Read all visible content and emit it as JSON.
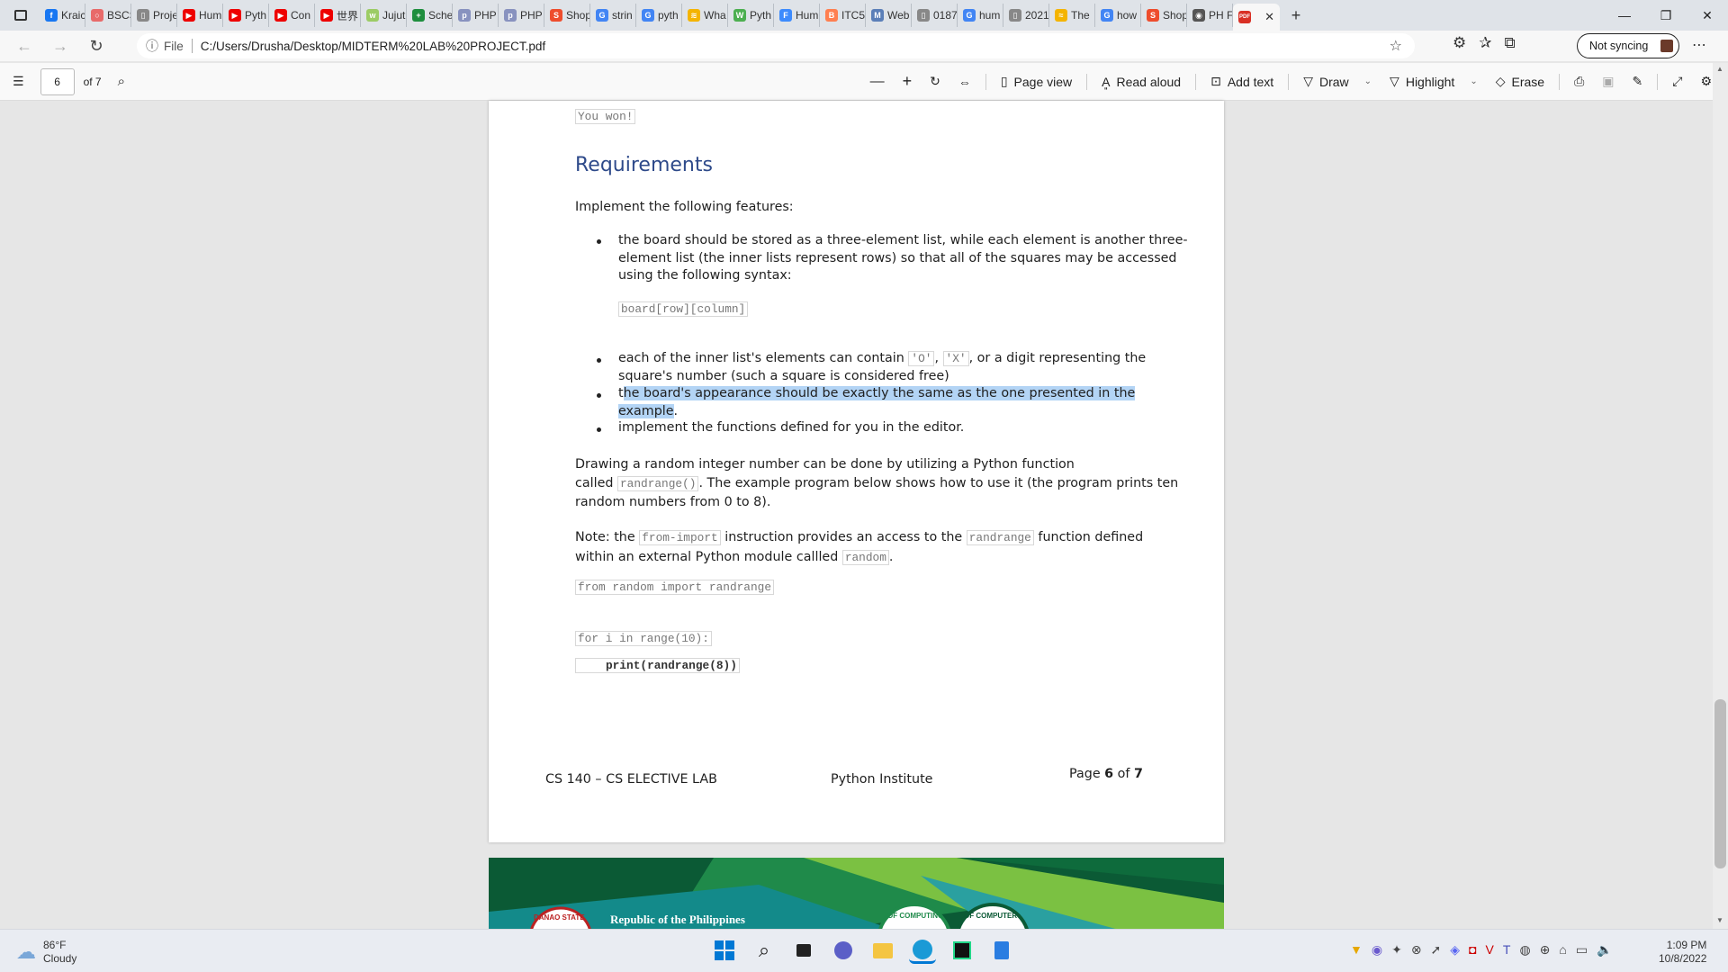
{
  "tabs": [
    {
      "label": "Kraic",
      "color": "#1877f2",
      "glyph": "f"
    },
    {
      "label": "BSCS",
      "color": "#e86a6a",
      "glyph": "○"
    },
    {
      "label": "Proje",
      "color": "#888",
      "glyph": "▯"
    },
    {
      "label": "Hum",
      "color": "#e00",
      "glyph": "▶"
    },
    {
      "label": "Pyth",
      "color": "#e00",
      "glyph": "▶"
    },
    {
      "label": "Con",
      "color": "#e00",
      "glyph": "▶"
    },
    {
      "label": "世界",
      "color": "#e00",
      "glyph": "▶"
    },
    {
      "label": "Jujut",
      "color": "#9ccc65",
      "glyph": "w"
    },
    {
      "label": "Sche",
      "color": "#1e8e3e",
      "glyph": "+"
    },
    {
      "label": "PHP",
      "color": "#8892bf",
      "glyph": "p"
    },
    {
      "label": "PHP",
      "color": "#8892bf",
      "glyph": "p"
    },
    {
      "label": "Shop",
      "color": "#ee4d2d",
      "glyph": "S"
    },
    {
      "label": "strin",
      "color": "#4285f4",
      "glyph": "G"
    },
    {
      "label": "pyth",
      "color": "#4285f4",
      "glyph": "G"
    },
    {
      "label": "Wha",
      "color": "#f4b400",
      "glyph": "≋"
    },
    {
      "label": "Pyth",
      "color": "#4caf50",
      "glyph": "W"
    },
    {
      "label": "Hum",
      "color": "#3d8bfd",
      "glyph": "F"
    },
    {
      "label": "ITC5",
      "color": "#ff7f50",
      "glyph": "B"
    },
    {
      "label": "Web",
      "color": "#5b7fb8",
      "glyph": "M"
    },
    {
      "label": "0187",
      "color": "#888",
      "glyph": "▯"
    },
    {
      "label": "hum",
      "color": "#4285f4",
      "glyph": "G"
    },
    {
      "label": "2021",
      "color": "#888",
      "glyph": "▯"
    },
    {
      "label": "The",
      "color": "#f4b400",
      "glyph": "≈"
    },
    {
      "label": "how",
      "color": "#4285f4",
      "glyph": "G"
    },
    {
      "label": "Shop",
      "color": "#ee4d2d",
      "glyph": "S"
    },
    {
      "label": "PH F",
      "color": "#555",
      "glyph": "◉"
    }
  ],
  "active_tab": {
    "glyph": "PDF",
    "close": "✕"
  },
  "newtab": "+",
  "window": {
    "minimize": "—",
    "restore": "❐",
    "close": "✕"
  },
  "address": {
    "info": "ⓘ",
    "scheme": "File",
    "url": "C:/Users/Drusha/Desktop/MIDTERM%20LAB%20PROJECT.pdf"
  },
  "sync": {
    "label": "Not syncing"
  },
  "pdf_toolbar": {
    "page_input": "6",
    "page_total": "of 7",
    "zoom_out": "—",
    "zoom_in": "+",
    "page_view": "Page view",
    "read_aloud": "Read aloud",
    "add_text": "Add text",
    "draw": "Draw",
    "highlight": "Highlight",
    "erase": "Erase"
  },
  "doc": {
    "top_code": "You won!",
    "heading": "Requirements",
    "intro": "Implement the following features:",
    "b1_l1": "the board should be stored as a three-element list, while each element is another three-",
    "b1_l2": "element list (the inner lists represent rows) so that all of the squares may be accessed",
    "b1_l3": "using the following syntax:",
    "b1_code": "board[row][column]",
    "b2_pre": "each of the inner list's elements can contain ",
    "b2_code1": "'O'",
    "b2_comma": ", ",
    "b2_code2": "'X'",
    "b2_post": ", or a digit representing the",
    "b2_l2": "square's number (such a square is considered free)",
    "b3_first": "t",
    "b3_hl1": "he board's appearance should be exactly the same as the one presented in the",
    "b3_hl2": "example",
    "b3_end": ".",
    "b4": "implement the functions defined for you in the editor.",
    "p1_l1": "Drawing a random integer number can be done by utilizing a Python function",
    "p1_pre": "called ",
    "p1_code": "randrange()",
    "p1_post": ". The example program below shows how to use it (the program prints ten",
    "p1_l3": "random numbers from 0 to 8).",
    "note_pre": "Note: the ",
    "note_code1": "from-import",
    "note_mid": " instruction provides an access to the ",
    "note_code2": "randrange",
    "note_post": " function defined",
    "note_l2_pre": "within an external Python module callled ",
    "note_code3": "random",
    "note_l2_post": ".",
    "code1": "from random import randrange",
    "code2": "for i in range(10):",
    "code3": "print(randrange(8))",
    "footer_left": "CS 140 – CS ELECTIVE LAB",
    "footer_mid": "Python Institute",
    "footer_page_pre": "Page ",
    "footer_page_num": "6",
    "footer_page_of": " of ",
    "footer_page_total": "7"
  },
  "next_page": {
    "header_text": "Republic of the Philippines",
    "seal_left": "DANAO STATE",
    "seal_mid": "OF COMPUTING",
    "seal_right": "OF COMPUTER"
  },
  "weather": {
    "temp": "86°F",
    "cond": "Cloudy"
  },
  "clock": {
    "time": "1:09 PM",
    "date": "10/8/2022"
  },
  "colors": {
    "heading": "#2e4a8a",
    "highlight": "#b3d4f5",
    "tab_strip": "#dfe3e8",
    "taskbar": "#e9ecf2"
  }
}
